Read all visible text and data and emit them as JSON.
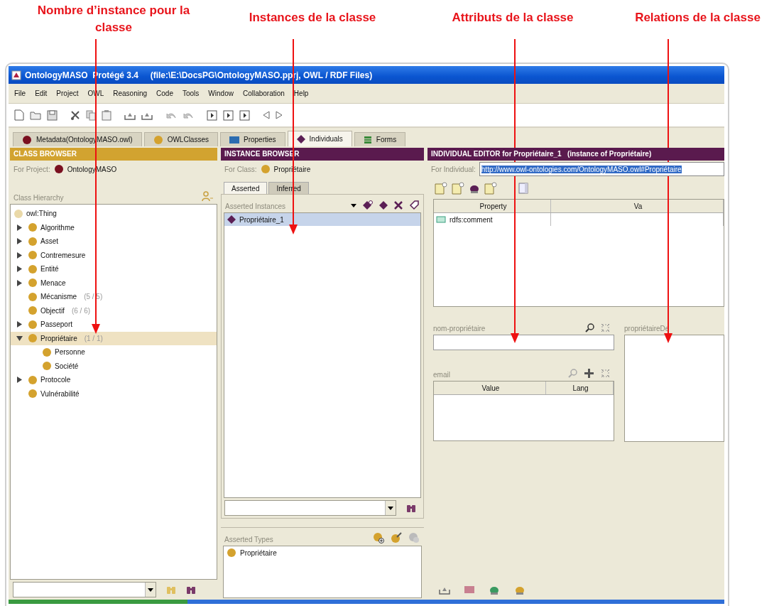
{
  "annotations": [
    {
      "text": "Nombre d’instance pour la classe",
      "kind": "count"
    },
    {
      "text": "Instances de la classe",
      "kind": "instances"
    },
    {
      "text": "Attributs de la classe",
      "kind": "attributes"
    },
    {
      "text": "Relations de la classe",
      "kind": "relations"
    }
  ],
  "window": {
    "title": "OntologyMASO  Protégé 3.4     (file:\\E:\\DocsPG\\OntologyMASO.pprj, OWL / RDF Files)"
  },
  "menu": [
    "File",
    "Edit",
    "Project",
    "OWL",
    "Reasoning",
    "Code",
    "Tools",
    "Window",
    "Collaboration",
    "Help"
  ],
  "tabs": [
    {
      "label": "Metadata(OntologyMASO.owl)",
      "kind": "metadata",
      "selected": false
    },
    {
      "label": "OWLClasses",
      "kind": "classes",
      "selected": false
    },
    {
      "label": "Properties",
      "kind": "properties",
      "selected": false
    },
    {
      "label": "Individuals",
      "kind": "individuals",
      "selected": true
    },
    {
      "label": "Forms",
      "kind": "forms",
      "selected": false
    }
  ],
  "class_browser": {
    "title": "CLASS BROWSER",
    "project_label": "For Project:",
    "project": "OntologyMASO",
    "hierarchy_label": "Class Hierarchy",
    "tree": [
      {
        "label": "owl:Thing",
        "kind": "root",
        "selected": false,
        "children": [
          {
            "label": "Algorithme",
            "kind": "branch",
            "expanded": false,
            "selected": false
          },
          {
            "label": "Asset",
            "kind": "branch",
            "expanded": false,
            "selected": false
          },
          {
            "label": "Contremesure",
            "kind": "branch",
            "expanded": false,
            "selected": false
          },
          {
            "label": "Entité",
            "kind": "branch",
            "expanded": false,
            "selected": false
          },
          {
            "label": "Menace",
            "kind": "branch",
            "expanded": false,
            "selected": false
          },
          {
            "label": "Mécanisme",
            "kind": "leaf",
            "count": "(5 / 5)",
            "selected": false
          },
          {
            "label": "Objectif",
            "kind": "leaf",
            "count": "(6 / 6)",
            "selected": false
          },
          {
            "label": "Passeport",
            "kind": "branch",
            "expanded": false,
            "selected": false
          },
          {
            "label": "Propriétaire",
            "kind": "branch",
            "expanded": true,
            "count": "(1 / 1)",
            "selected": true,
            "children": [
              {
                "label": "Personne",
                "kind": "leaf",
                "selected": false
              },
              {
                "label": "Société",
                "kind": "leaf",
                "selected": false
              }
            ]
          },
          {
            "label": "Protocole",
            "kind": "branch",
            "expanded": false,
            "selected": false
          },
          {
            "label": "Vulnérabilité",
            "kind": "leaf",
            "selected": false
          }
        ]
      }
    ]
  },
  "instance_browser": {
    "title": "INSTANCE BROWSER",
    "class_label": "For Class:",
    "class_name": "Propriétaire",
    "tabs": [
      {
        "label": "Asserted",
        "selected": true
      },
      {
        "label": "Inferred",
        "selected": false
      }
    ],
    "instances_label": "Asserted Instances",
    "instances": [
      {
        "label": "Propriétaire_1",
        "selected": true
      }
    ],
    "types_label": "Asserted Types",
    "types": [
      {
        "label": "Propriétaire"
      }
    ]
  },
  "individual_editor": {
    "title": "INDIVIDUAL EDITOR for Propriétaire_1   (instance of Propriétaire)",
    "individual_label": "For Individual:",
    "individual_uri": "http://www.owl-ontologies.com/OntologyMASO.owl#Propriétaire",
    "property_table": {
      "columns": [
        "Property",
        "Va"
      ],
      "rows": [
        {
          "property": "rdfs:comment"
        }
      ]
    },
    "name_label": "nom-propriétaire",
    "email_label": "email",
    "email_columns": [
      "Value",
      "Lang"
    ],
    "relation_label": "propriétaireDe"
  }
}
